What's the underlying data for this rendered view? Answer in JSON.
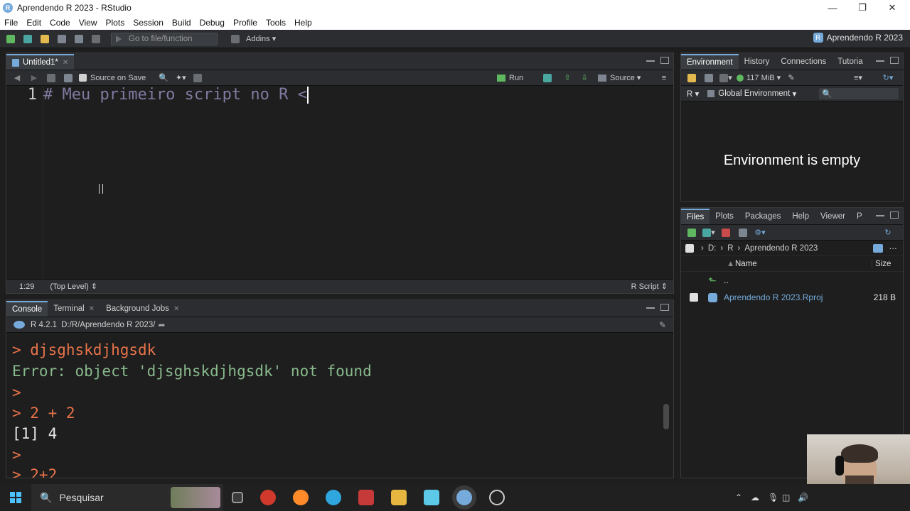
{
  "window": {
    "title": "Aprendendo R 2023 - RStudio",
    "app_badge": "R"
  },
  "menu": [
    "File",
    "Edit",
    "Code",
    "View",
    "Plots",
    "Session",
    "Build",
    "Debug",
    "Profile",
    "Tools",
    "Help"
  ],
  "toolbar": {
    "goto_placeholder": "Go to file/function",
    "addins_label": "Addins",
    "project_name": "Aprendendo R 2023"
  },
  "editor": {
    "tab_label": "Untitled1*",
    "source_on_save": "Source on Save",
    "run_label": "Run",
    "source_label": "Source",
    "line_number": "1",
    "code_text": "# Meu primeiro script no R <",
    "cursor_position": "1:29",
    "scope": "(Top Level)",
    "file_type": "R Script"
  },
  "console": {
    "tabs": [
      "Console",
      "Terminal",
      "Background Jobs"
    ],
    "r_version": "R 4.2.1",
    "working_dir": "D:/R/Aprendendo R 2023/",
    "lines": [
      {
        "type": "cmd",
        "text": "> djsghskdjhgsdk"
      },
      {
        "type": "err",
        "text": "Error: object 'djsghskdjhgsdk' not found"
      },
      {
        "type": "cmd",
        "text": ">"
      },
      {
        "type": "cmd",
        "text": "> 2 + 2"
      },
      {
        "type": "out",
        "text": "[1] 4"
      },
      {
        "type": "cmd",
        "text": ">"
      },
      {
        "type": "cmd",
        "text": "> 2+2"
      }
    ]
  },
  "environment": {
    "tabs": [
      "Environment",
      "History",
      "Connections",
      "Tutoria"
    ],
    "memory": "117 MiB",
    "language": "R",
    "scope": "Global Environment",
    "empty_text": "Environment is empty"
  },
  "files": {
    "tabs": [
      "Files",
      "Plots",
      "Packages",
      "Help",
      "Viewer",
      "P"
    ],
    "crumbs": [
      "D:",
      "R",
      "Aprendendo R 2023"
    ],
    "col_name": "Name",
    "col_size": "Size",
    "parent_label": "..",
    "rows": [
      {
        "name": "Aprendendo R 2023.Rproj",
        "size": "218 B"
      }
    ]
  },
  "taskbar": {
    "search_placeholder": "Pesquisar"
  },
  "colors": {
    "accent": "#75aadb",
    "console_cmd": "#e8734a",
    "console_err": "#88b98c",
    "comment": "#7f7ba0"
  }
}
